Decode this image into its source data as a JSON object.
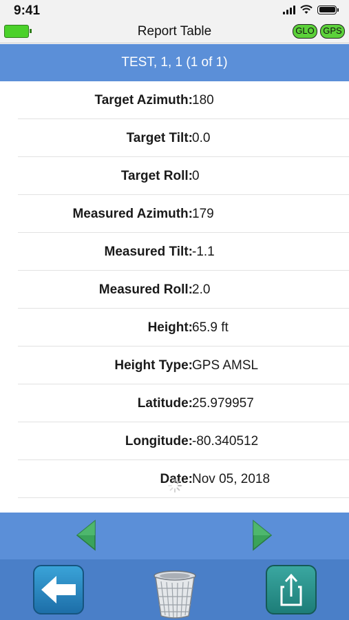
{
  "status": {
    "time": "9:41"
  },
  "nav": {
    "title": "Report Table",
    "badges": [
      "GLO",
      "GPS"
    ]
  },
  "record": {
    "header": "TEST, 1, 1 (1 of 1)"
  },
  "rows": [
    {
      "label": "Target Azimuth:",
      "value": "180"
    },
    {
      "label": "Target Tilt:",
      "value": "0.0"
    },
    {
      "label": "Target Roll:",
      "value": "0"
    },
    {
      "label": "Measured Azimuth:",
      "value": "179"
    },
    {
      "label": "Measured Tilt:",
      "value": "-1.1"
    },
    {
      "label": "Measured Roll:",
      "value": "2.0"
    },
    {
      "label": "Height:",
      "value": "65.9 ft"
    },
    {
      "label": "Height Type:",
      "value": "GPS AMSL"
    },
    {
      "label": "Latitude:",
      "value": "25.979957"
    },
    {
      "label": "Longitude:",
      "value": "-80.340512"
    },
    {
      "label": "Date:",
      "value": "Nov 05, 2018"
    }
  ],
  "icons": {
    "prev": "left-arrow-icon",
    "next": "right-arrow-icon",
    "back": "back-arrow-icon",
    "trash": "trash-can-icon",
    "share": "share-icon"
  },
  "colors": {
    "header_blue": "#5b8fd8",
    "toolbar_blue": "#4a7fc8",
    "arrow_green": "#3aa35a",
    "battery_green": "#4bd12a"
  }
}
